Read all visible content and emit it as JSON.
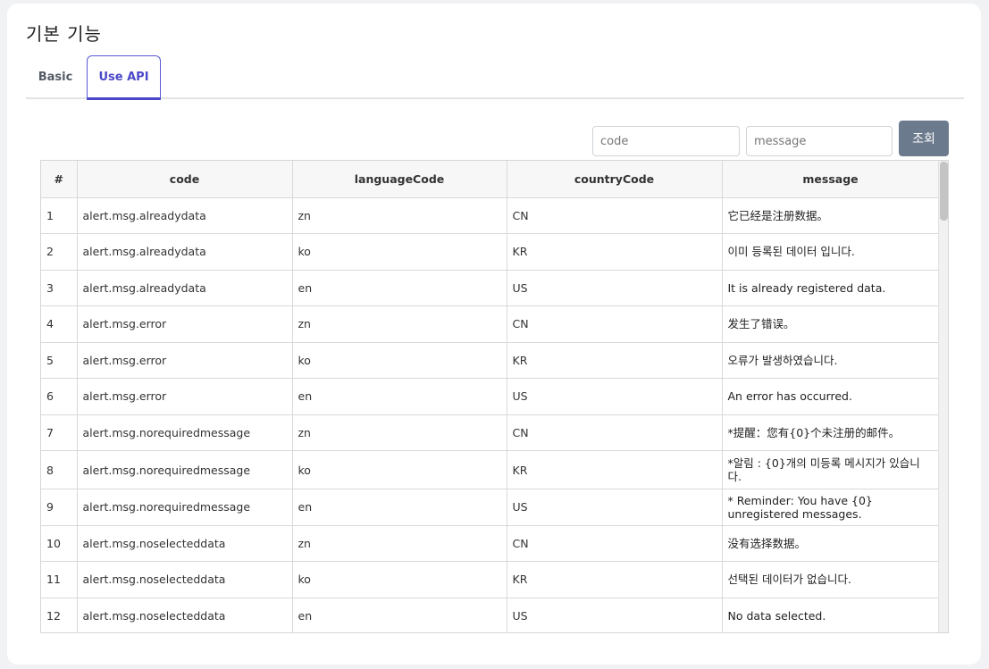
{
  "page": {
    "title": "기본 기능"
  },
  "tabs": [
    {
      "label": "Basic",
      "active": false
    },
    {
      "label": "Use API",
      "active": true
    }
  ],
  "search": {
    "code_placeholder": "code",
    "message_placeholder": "message",
    "query_label": "조회"
  },
  "table": {
    "headers": [
      "#",
      "code",
      "languageCode",
      "countryCode",
      "message"
    ],
    "rows": [
      [
        "1",
        "alert.msg.alreadydata",
        "zn",
        "CN",
        "它已经是注册数据。"
      ],
      [
        "2",
        "alert.msg.alreadydata",
        "ko",
        "KR",
        "이미 등록된 데이터 입니다."
      ],
      [
        "3",
        "alert.msg.alreadydata",
        "en",
        "US",
        "It is already registered data."
      ],
      [
        "4",
        "alert.msg.error",
        "zn",
        "CN",
        "发生了错误。"
      ],
      [
        "5",
        "alert.msg.error",
        "ko",
        "KR",
        "오류가 발생하였습니다."
      ],
      [
        "6",
        "alert.msg.error",
        "en",
        "US",
        "An error has occurred."
      ],
      [
        "7",
        "alert.msg.norequiredmessage",
        "zn",
        "CN",
        "*提醒：您有{0}个未注册的邮件。"
      ],
      [
        "8",
        "alert.msg.norequiredmessage",
        "ko",
        "KR",
        "*알림 : {0}개의 미등록 메시지가 있습니다."
      ],
      [
        "9",
        "alert.msg.norequiredmessage",
        "en",
        "US",
        "* Reminder: You have {0} unregistered messages."
      ],
      [
        "10",
        "alert.msg.noselecteddata",
        "zn",
        "CN",
        "没有选择数据。"
      ],
      [
        "11",
        "alert.msg.noselecteddata",
        "ko",
        "KR",
        "선택된 데이터가 없습니다."
      ],
      [
        "12",
        "alert.msg.noselecteddata",
        "en",
        "US",
        "No data selected."
      ]
    ]
  },
  "colors": {
    "accent": "#4a48c8",
    "button": "#6c7a8d"
  }
}
